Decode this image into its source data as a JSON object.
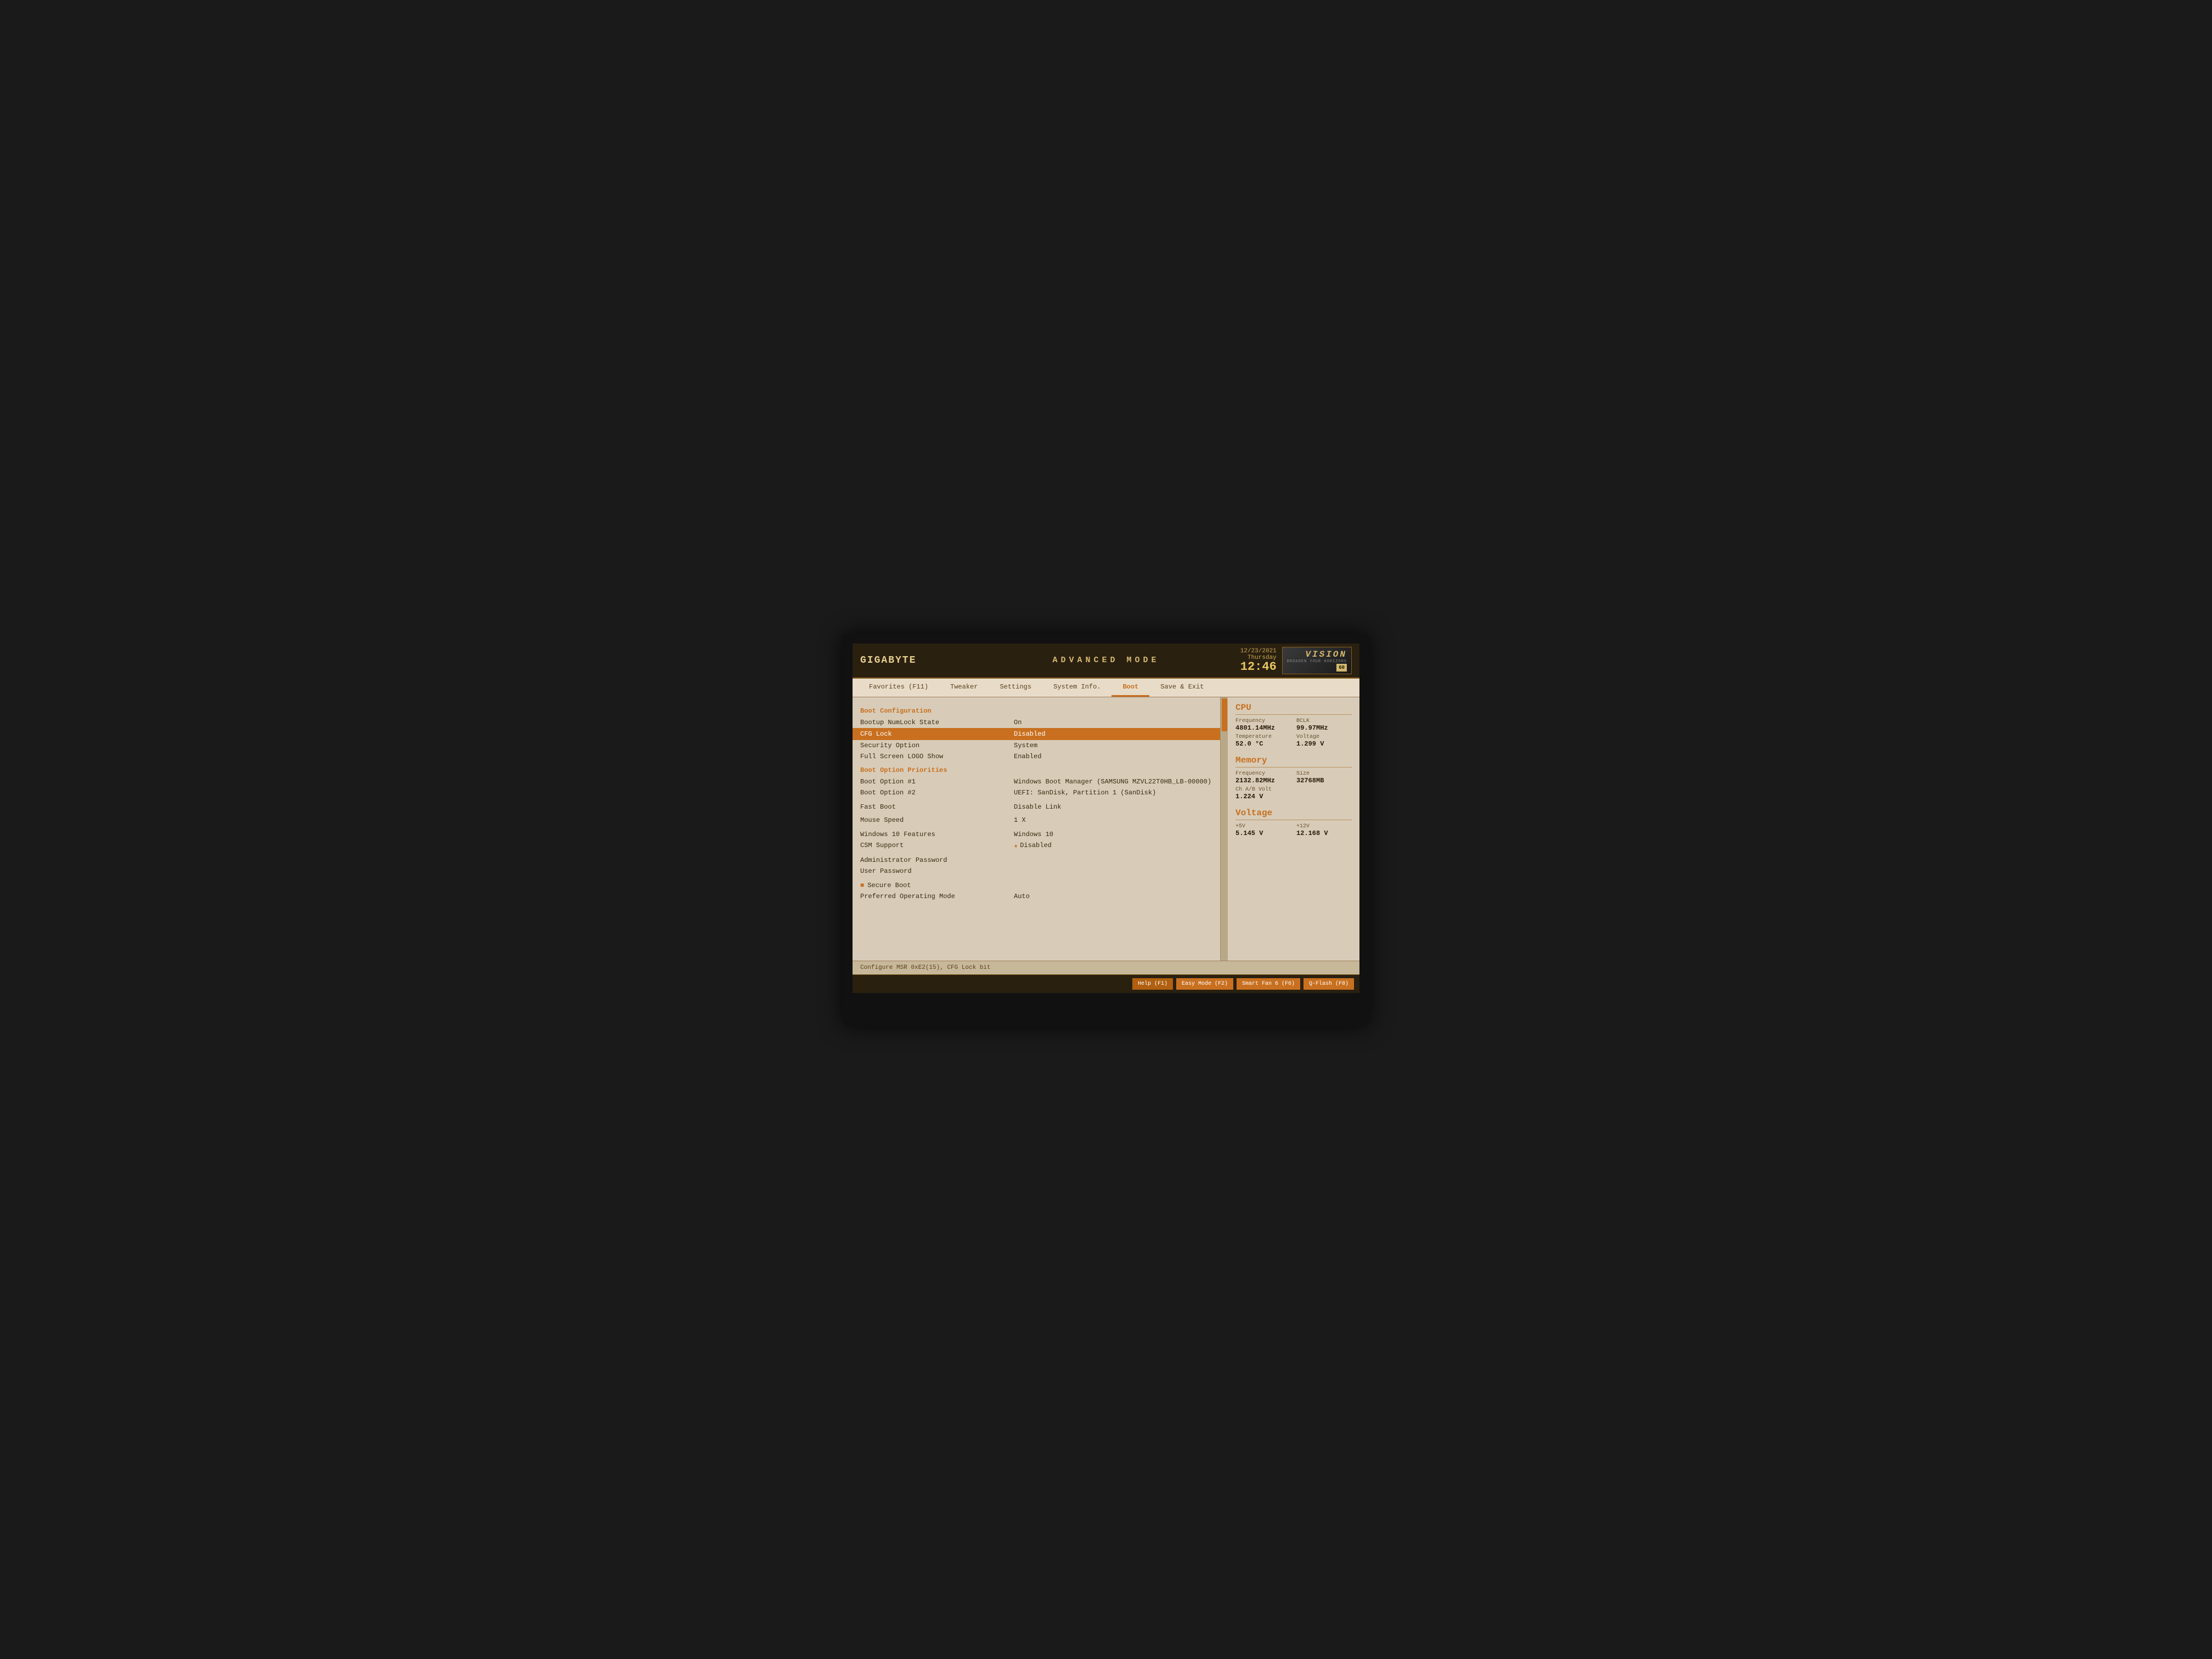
{
  "header": {
    "logo": "GIGABYTE",
    "mode_title": "ADVANCED MODE",
    "date": "12/23/2021",
    "day": "Thursday",
    "time": "12:46",
    "vision_brand": "VISION",
    "broaden_text": "BROADEN YOUR HORIZONS",
    "fan_speed": "60"
  },
  "nav": {
    "items": [
      {
        "id": "favorites",
        "label": "Favorites (F11)",
        "active": false
      },
      {
        "id": "tweaker",
        "label": "Tweaker",
        "active": false
      },
      {
        "id": "settings",
        "label": "Settings",
        "active": false
      },
      {
        "id": "sysinfo",
        "label": "System Info.",
        "active": false
      },
      {
        "id": "boot",
        "label": "Boot",
        "active": true
      },
      {
        "id": "save_exit",
        "label": "Save & Exit",
        "active": false
      }
    ]
  },
  "boot_settings": {
    "section1_header": "Boot Configuration",
    "rows": [
      {
        "id": "bootup_numlock",
        "label": "Bootup NumLock State",
        "value": "On",
        "highlighted": false,
        "bullet": false,
        "star": false
      },
      {
        "id": "cfg_lock",
        "label": "CFG Lock",
        "value": "Disabled",
        "highlighted": true,
        "bullet": false,
        "star": false
      },
      {
        "id": "security_option",
        "label": "Security Option",
        "value": "System",
        "highlighted": false,
        "bullet": false,
        "star": false
      },
      {
        "id": "full_screen_logo",
        "label": "Full Screen LOGO Show",
        "value": "Enabled",
        "highlighted": false,
        "bullet": false,
        "star": false
      }
    ],
    "section2_header": "Boot Option Priorities",
    "boot_options": [
      {
        "id": "boot_option1",
        "label": "Boot Option #1",
        "value": "Windows Boot Manager (SAMSUNG MZVL22T0HB_LB-00000)"
      },
      {
        "id": "boot_option2",
        "label": "Boot Option #2",
        "value": "UEFI: SanDisk, Partition 1 (SanDisk)"
      }
    ],
    "other_rows": [
      {
        "id": "fast_boot",
        "label": "Fast Boot",
        "value": "Disable Link",
        "bullet": false,
        "star": false
      },
      {
        "id": "mouse_speed",
        "label": "Mouse Speed",
        "value": "1 X",
        "bullet": false,
        "star": false
      },
      {
        "id": "win10_features",
        "label": "Windows 10 Features",
        "value": "Windows 10",
        "bullet": false,
        "star": false
      },
      {
        "id": "csm_support",
        "label": "CSM Support",
        "value": "Disabled",
        "bullet": false,
        "star": true
      },
      {
        "id": "admin_password",
        "label": "Administrator Password",
        "value": "",
        "bullet": false,
        "star": false
      },
      {
        "id": "user_password",
        "label": "User Password",
        "value": "",
        "bullet": false,
        "star": false
      },
      {
        "id": "secure_boot",
        "label": "Secure Boot",
        "value": "",
        "bullet": true,
        "star": false
      },
      {
        "id": "preferred_os",
        "label": "Preferred Operating Mode",
        "value": "Auto",
        "bullet": false,
        "star": false
      }
    ]
  },
  "cpu_stats": {
    "title": "CPU",
    "frequency_label": "Frequency",
    "frequency_value": "4801.14MHz",
    "bclk_label": "BCLK",
    "bclk_value": "99.97MHz",
    "temp_label": "Temperature",
    "temp_value": "52.0 °C",
    "voltage_label": "Voltage",
    "voltage_value": "1.299 V"
  },
  "memory_stats": {
    "title": "Memory",
    "frequency_label": "Frequency",
    "frequency_value": "2132.82MHz",
    "size_label": "Size",
    "size_value": "32768MB",
    "ch_volt_label": "Ch A/B Volt",
    "ch_volt_value": "1.224 V"
  },
  "voltage_stats": {
    "title": "Voltage",
    "v5_label": "+5V",
    "v5_value": "5.145 V",
    "v12_label": "+12V",
    "v12_value": "12.168 V"
  },
  "status_bar": {
    "text": "Configure MSR 0xE2(15), CFG Lock bit"
  },
  "toolbar": {
    "buttons": [
      {
        "id": "help",
        "label": "Help (F1)"
      },
      {
        "id": "easy_mode",
        "label": "Easy Mode (F2)"
      },
      {
        "id": "smart_fan",
        "label": "Smart Fan 6 (F6)"
      },
      {
        "id": "q_flash",
        "label": "Q-Flash (F8)"
      }
    ]
  }
}
